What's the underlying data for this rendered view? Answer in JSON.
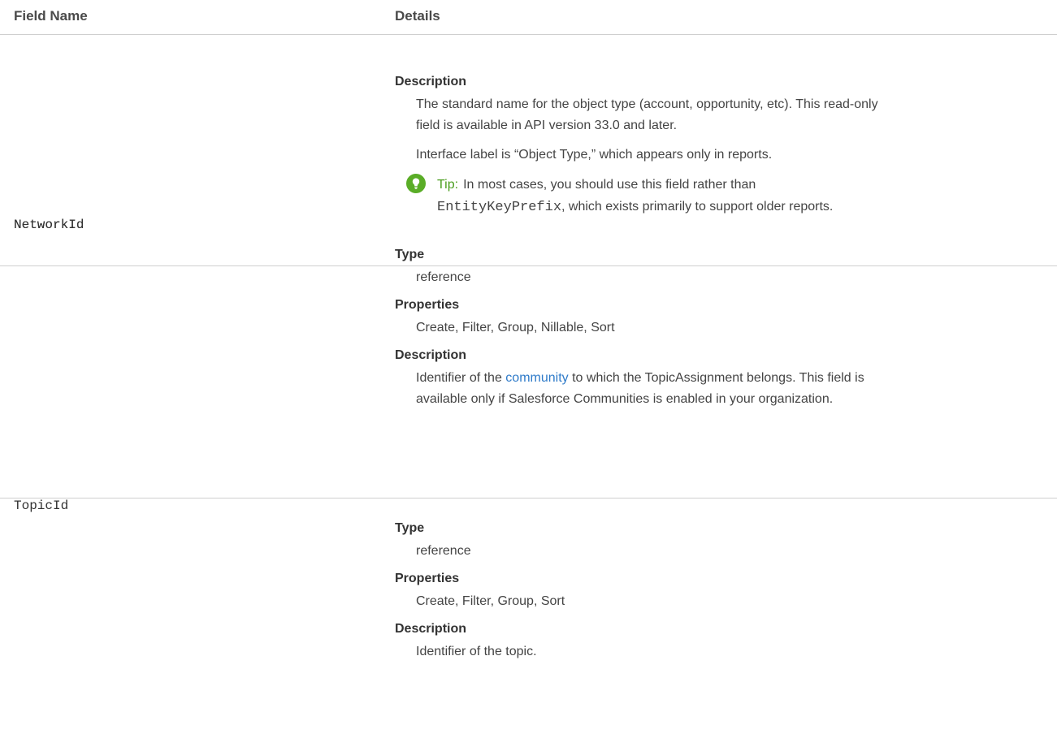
{
  "header": {
    "col1": "Field Name",
    "col2": "Details"
  },
  "rows": [
    {
      "name": "",
      "description_label": "Description",
      "description_line1": "The standard name for the object type (account, opportunity, etc). This read-only",
      "description_line2": "field is available in API version 33.0 and later.",
      "interface_text": "Interface label is “Object Type,” which appears only in reports.",
      "tip_label": "Tip:",
      "tip_line1": "In most cases, you should use this field rather than",
      "tip_code": "EntityKeyPrefix",
      "tip_line2_rest": ", which exists primarily to support older reports."
    },
    {
      "name": "NetworkId",
      "type_label": "Type",
      "type_value": "reference",
      "properties_label": "Properties",
      "properties_value": "Create, Filter, Group, Nillable, Sort",
      "description_label": "Description",
      "description_prefix": "Identifier of the ",
      "description_link": "community",
      "description_suffix": " to which the TopicAssignment belongs. This field is",
      "description_line2": "available only if Salesforce Communities is enabled in your organization."
    },
    {
      "name": "TopicId",
      "type_label": "Type",
      "type_value": "reference",
      "properties_label": "Properties",
      "properties_value": "Create, Filter, Group, Sort",
      "description_label": "Description",
      "description_value": "Identifier of the topic."
    }
  ],
  "colors": {
    "tip_green": "#5aad27",
    "link_blue": "#2f7bc9"
  },
  "icons": {
    "tip": "lightbulb-icon"
  }
}
